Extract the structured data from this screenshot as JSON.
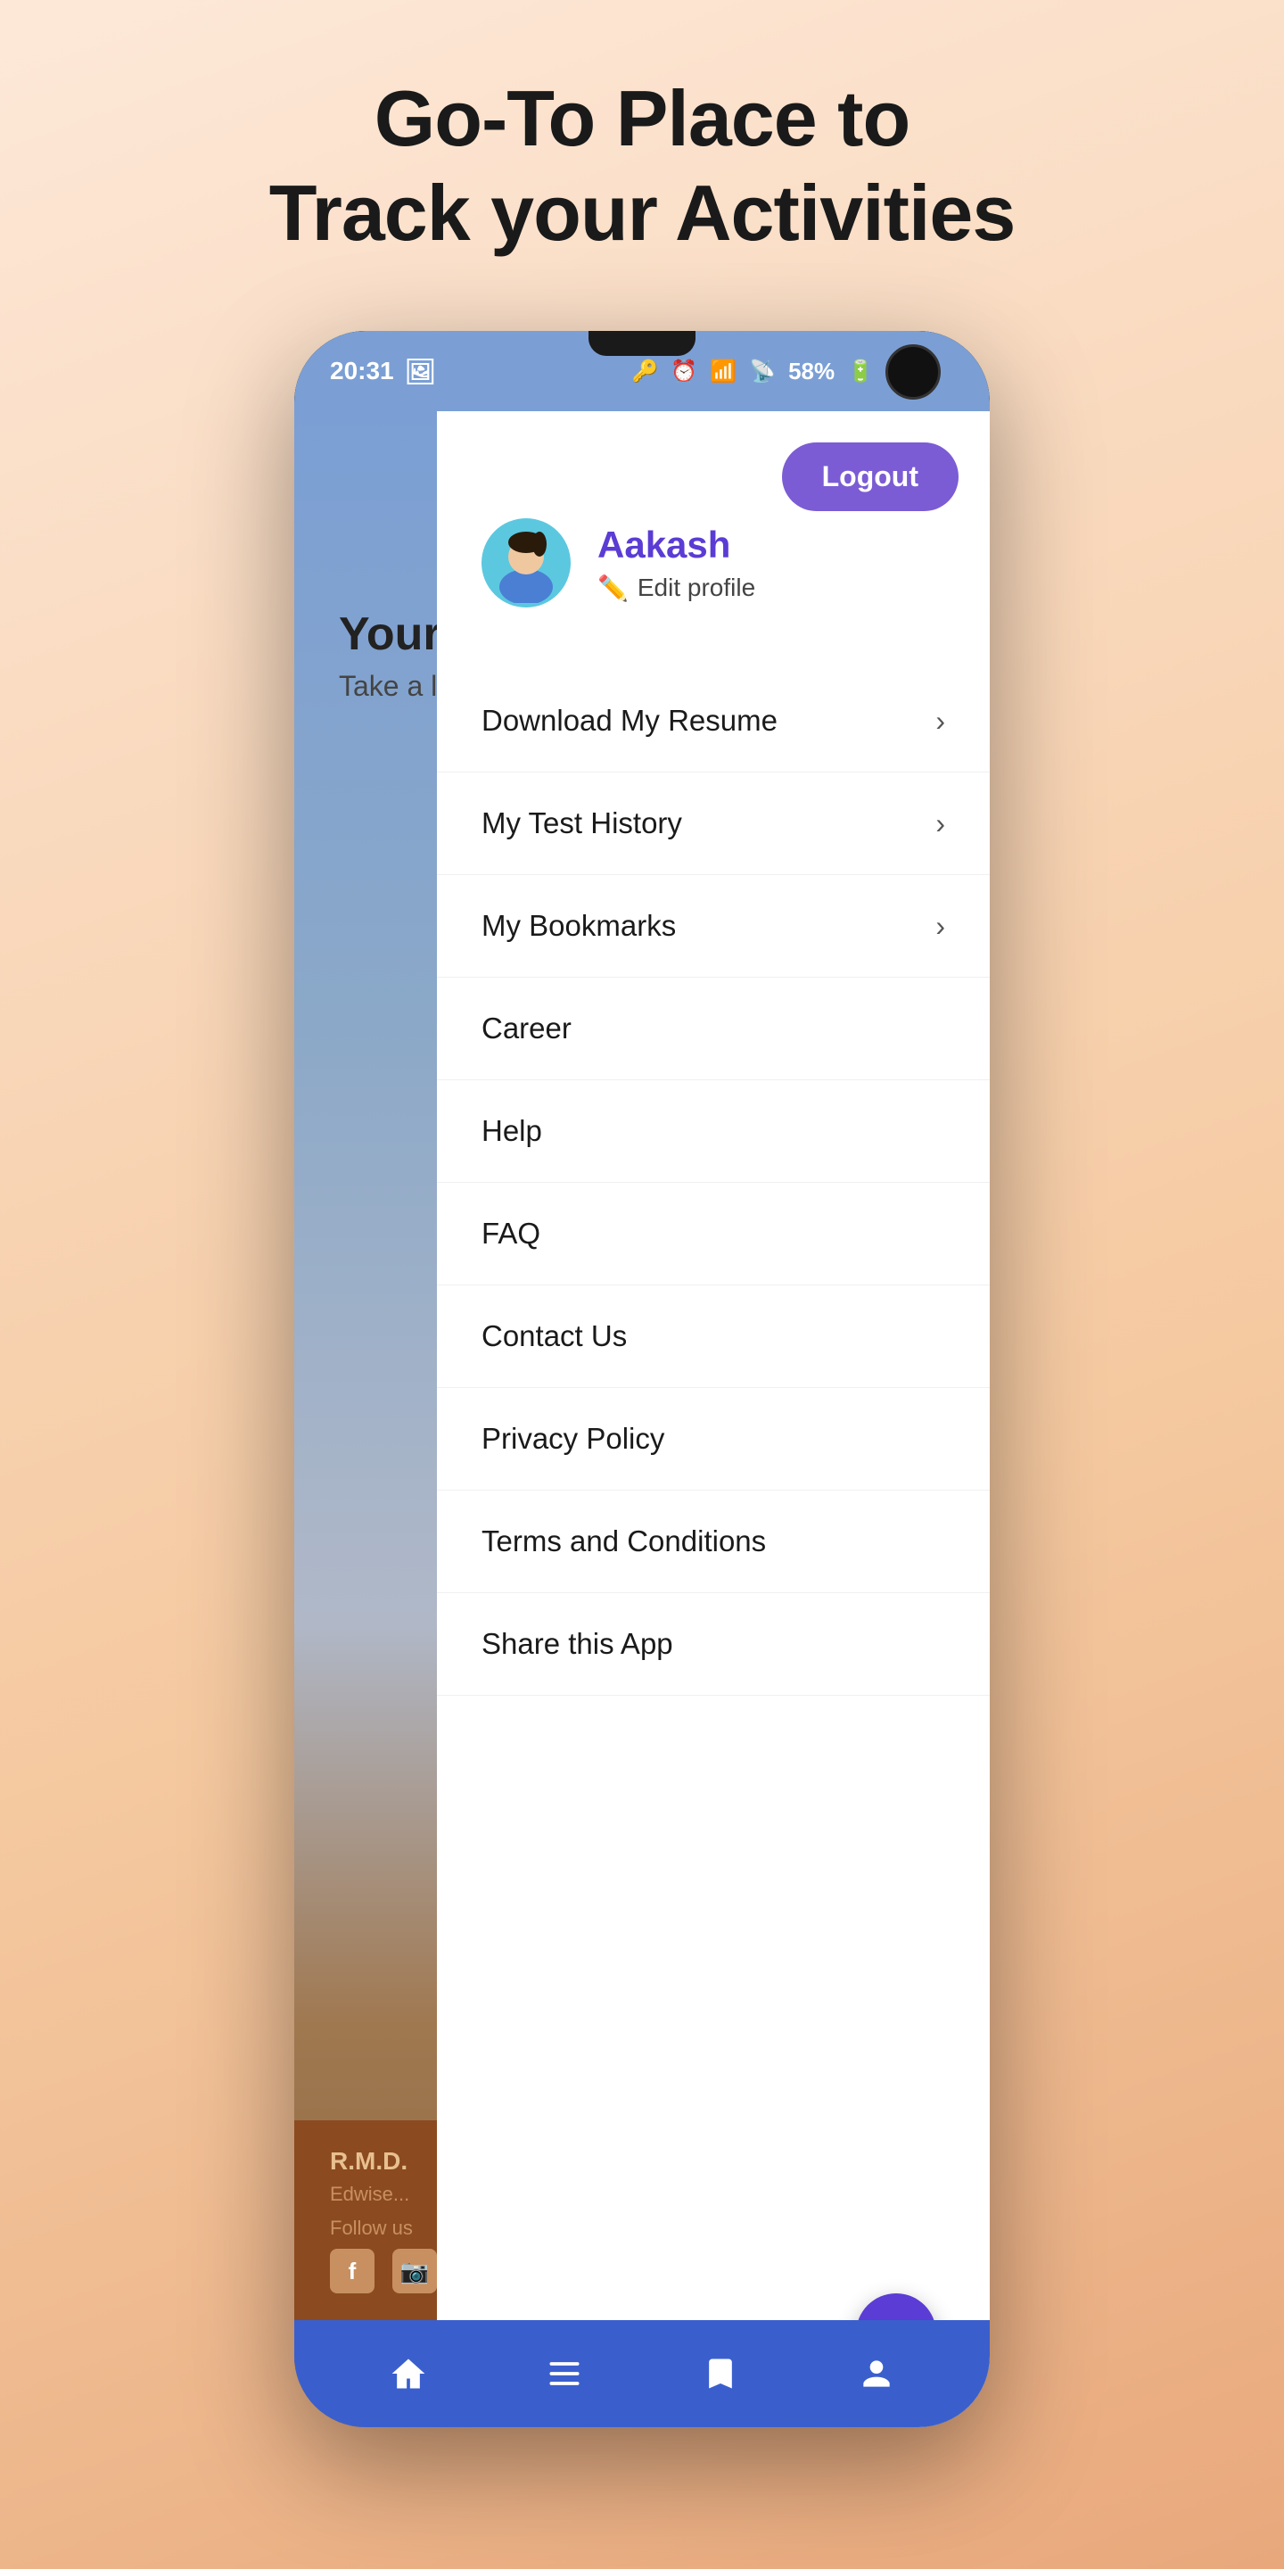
{
  "page": {
    "title_line1": "Go-To Place to",
    "title_line2": "Track your Activities"
  },
  "status_bar": {
    "time": "20:31",
    "battery": "58%"
  },
  "logout_button": {
    "label": "Logout"
  },
  "user": {
    "name": "Aakash",
    "edit_label": "Edit profile"
  },
  "menu": {
    "items_with_arrow": [
      {
        "label": "Download My Resume"
      },
      {
        "label": "My Test History"
      },
      {
        "label": "My Bookmarks"
      }
    ],
    "items_plain": [
      {
        "label": "Career"
      },
      {
        "label": "Help"
      },
      {
        "label": "FAQ"
      },
      {
        "label": "Contact Us"
      },
      {
        "label": "Privacy Policy"
      },
      {
        "label": "Terms and Conditions"
      },
      {
        "label": "Share this App"
      }
    ]
  },
  "bg_content": {
    "your_text": "Your",
    "sub_text": "Take a lo..."
  },
  "brown_footer": {
    "title": "R.M.D.",
    "sub": "Edwise...",
    "follow": "Follow us"
  }
}
